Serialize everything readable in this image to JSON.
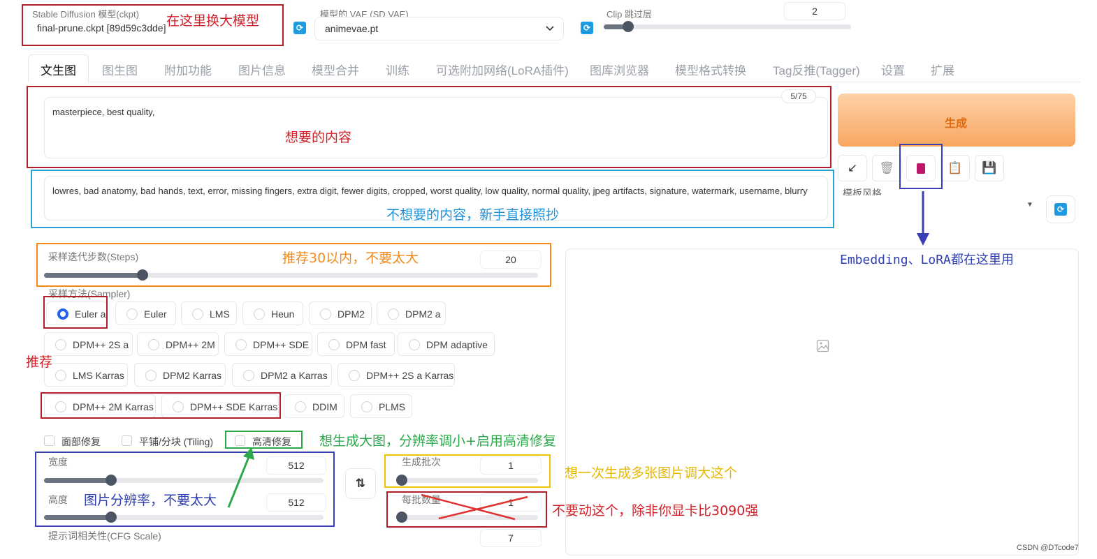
{
  "top": {
    "model_label": "Stable Diffusion 模型(ckpt)",
    "model_value": "final-prune.ckpt [89d59c3dde]",
    "vae_label": "模型的 VAE (SD VAE)",
    "vae_value": "animevae.pt",
    "clip_label": "Clip 跳过层",
    "clip_value": "2",
    "clip_level": 0.1
  },
  "tabs": [
    "文生图",
    "图生图",
    "附加功能",
    "图片信息",
    "模型合并",
    "训练",
    "可选附加网络(LoRA插件)",
    "图库浏览器",
    "模型格式转换",
    "Tag反推(Tagger)",
    "设置",
    "扩展"
  ],
  "prompt": {
    "positive": "masterpiece, best quality,",
    "token_count": "5/75",
    "negative": "lowres, bad anatomy, bad hands, text, error, missing fingers, extra digit, fewer digits, cropped, worst quality, low quality, normal quality, jpeg artifacts, signature, watermark, username, blurry"
  },
  "right": {
    "generate": "生成",
    "styles_label": "模板风格",
    "tool_icons": [
      "arrow-icon",
      "trash-icon",
      "extra-networks-icon",
      "clipboard-icon",
      "save-icon"
    ]
  },
  "steps": {
    "label": "采样迭代步数(Steps)",
    "value": "20",
    "level": 0.2
  },
  "sampler": {
    "label": "采样方法(Sampler)",
    "selected": "Euler a",
    "options": [
      [
        "Euler a",
        "Euler",
        "LMS",
        "Heun",
        "DPM2",
        "DPM2 a"
      ],
      [
        "DPM++ 2S a",
        "DPM++ 2M",
        "DPM++ SDE",
        "DPM fast",
        "DPM adaptive"
      ],
      [
        "LMS Karras",
        "DPM2 Karras",
        "DPM2 a Karras",
        "DPM++ 2S a Karras"
      ],
      [
        "DPM++ 2M Karras",
        "DPM++ SDE Karras",
        "DDIM",
        "PLMS"
      ]
    ]
  },
  "checks": {
    "face": "面部修复",
    "tiling": "平铺/分块 (Tiling)",
    "hires": "高清修复"
  },
  "size": {
    "width_label": "宽度",
    "width_value": "512",
    "height_label": "高度",
    "height_value": "512",
    "level": 0.24
  },
  "batch": {
    "count_label": "生成批次",
    "count_value": "1",
    "size_label": "每批数量",
    "size_value": "1"
  },
  "cfg": {
    "label": "提示词相关性(CFG Scale)",
    "value": "7"
  },
  "annotations": {
    "model": "在这里换大模型",
    "positive": "想要的内容",
    "negative": "不想要的内容，新手直接照抄",
    "steps": "推荐30以内，不要太大",
    "recommend": "推荐",
    "hires": "想生成大图，分辨率调小+启用高清修复",
    "resolution": "图片分辨率，不要太大",
    "batch_count": "想一次生成多张图片调大这个",
    "batch_size": "不要动这个，除非你显卡比3090强",
    "embedding": "Embedding、LoRA都在这里用"
  },
  "watermark": "CSDN @DTcode7",
  "colors": {
    "accent": "#2563eb",
    "generate": "#f7a25a",
    "refresh": "#1e9be0"
  }
}
